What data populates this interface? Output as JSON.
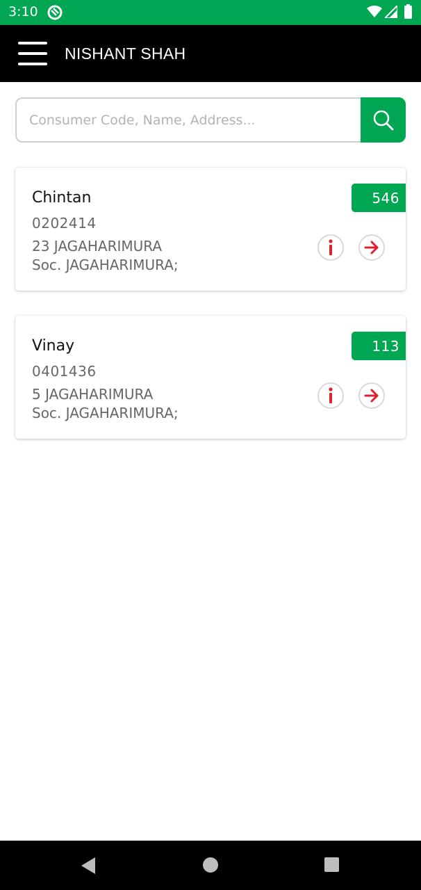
{
  "status_bar": {
    "time": "3:10",
    "icons": [
      "app-notification-icon",
      "wifi-icon",
      "signal-icon",
      "battery-icon"
    ]
  },
  "app_bar": {
    "title": "NISHANT SHAH",
    "menu_icon": "hamburger-menu-icon"
  },
  "search": {
    "placeholder": "Consumer Code, Name, Address...",
    "value": "",
    "button_icon": "search-icon"
  },
  "consumers": [
    {
      "name": "Chintan",
      "code": "0202414",
      "address_line1": "23 JAGAHARIMURA",
      "address_line2": "Soc. JAGAHARIMURA;",
      "badge": "546",
      "actions": [
        "info-icon",
        "arrow-right-icon"
      ]
    },
    {
      "name": "Vinay",
      "code": "0401436",
      "address_line1": "5 JAGAHARIMURA",
      "address_line2": "Soc. JAGAHARIMURA;",
      "badge": "113",
      "actions": [
        "info-icon",
        "arrow-right-icon"
      ]
    }
  ],
  "nav_bar": {
    "buttons": [
      "back-icon",
      "home-icon",
      "recents-icon"
    ]
  },
  "colors": {
    "primary": "#00a651",
    "app_bar": "#000000",
    "action_icon": "#e0202a",
    "text_secondary": "#666666"
  }
}
